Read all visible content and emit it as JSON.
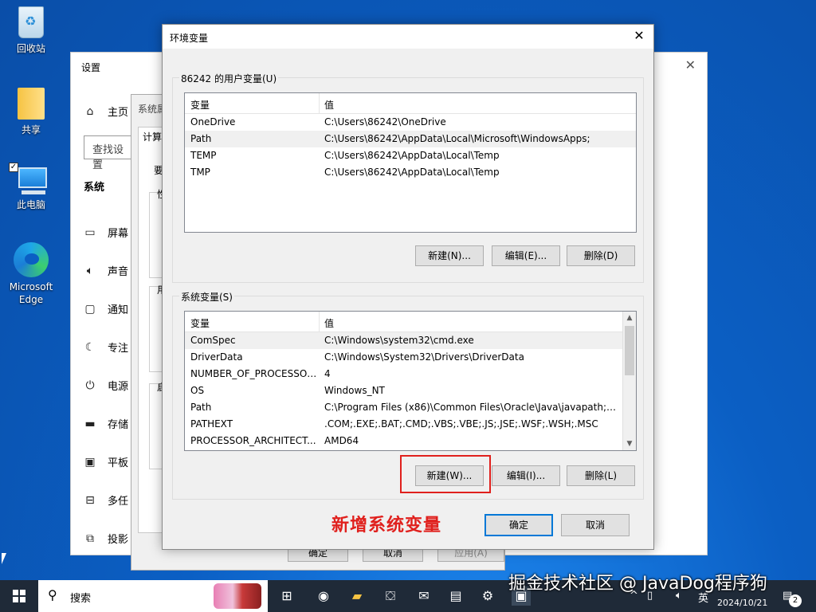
{
  "desktop": {
    "icons": [
      {
        "label": "回收站"
      },
      {
        "label": "共享"
      },
      {
        "label": "此电脑"
      },
      {
        "label": "Microsoft Edge"
      }
    ]
  },
  "settings": {
    "title": "设置",
    "home": "主页",
    "search_placeholder": "查找设置",
    "section": "系统",
    "items": [
      "屏幕",
      "声音",
      "通知",
      "专注",
      "电源",
      "存储",
      "平板",
      "多任",
      "投影"
    ]
  },
  "sysprops": {
    "title": "系统属",
    "tab": "计算",
    "snippets": [
      "要",
      "性",
      "用",
      "启"
    ],
    "ok": "确定",
    "cancel": "取消",
    "apply": "应用(A)"
  },
  "env": {
    "title": "环境变量",
    "user_group_label": "86242 的用户变量(U)",
    "header_var": "变量",
    "header_val": "值",
    "user_vars": [
      {
        "name": "OneDrive",
        "value": "C:\\Users\\86242\\OneDrive"
      },
      {
        "name": "Path",
        "value": "C:\\Users\\86242\\AppData\\Local\\Microsoft\\WindowsApps;"
      },
      {
        "name": "TEMP",
        "value": "C:\\Users\\86242\\AppData\\Local\\Temp"
      },
      {
        "name": "TMP",
        "value": "C:\\Users\\86242\\AppData\\Local\\Temp"
      }
    ],
    "user_new": "新建(N)...",
    "user_edit": "编辑(E)...",
    "user_delete": "删除(D)",
    "sys_group_label": "系统变量(S)",
    "sys_vars": [
      {
        "name": "ComSpec",
        "value": "C:\\Windows\\system32\\cmd.exe"
      },
      {
        "name": "DriverData",
        "value": "C:\\Windows\\System32\\Drivers\\DriverData"
      },
      {
        "name": "NUMBER_OF_PROCESSORS",
        "value": "4"
      },
      {
        "name": "OS",
        "value": "Windows_NT"
      },
      {
        "name": "Path",
        "value": "C:\\Program Files (x86)\\Common Files\\Oracle\\Java\\javapath;C:..."
      },
      {
        "name": "PATHEXT",
        "value": ".COM;.EXE;.BAT;.CMD;.VBS;.VBE;.JS;.JSE;.WSF;.WSH;.MSC"
      },
      {
        "name": "PROCESSOR_ARCHITECT...",
        "value": "AMD64"
      }
    ],
    "sys_new": "新建(W)...",
    "sys_edit": "编辑(I)...",
    "sys_delete": "删除(L)",
    "ok": "确定",
    "cancel": "取消",
    "annotation": "新增系统变量"
  },
  "taskbar": {
    "search_placeholder": "搜索",
    "ime": "英",
    "date": "2024/10/21",
    "notification_count": "2"
  },
  "watermark": "掘金技术社区 @ JavaDog程序狗",
  "colors": {
    "accent": "#0078d7",
    "annotation_red": "#e0201d",
    "taskbar": "#1f2a38"
  }
}
